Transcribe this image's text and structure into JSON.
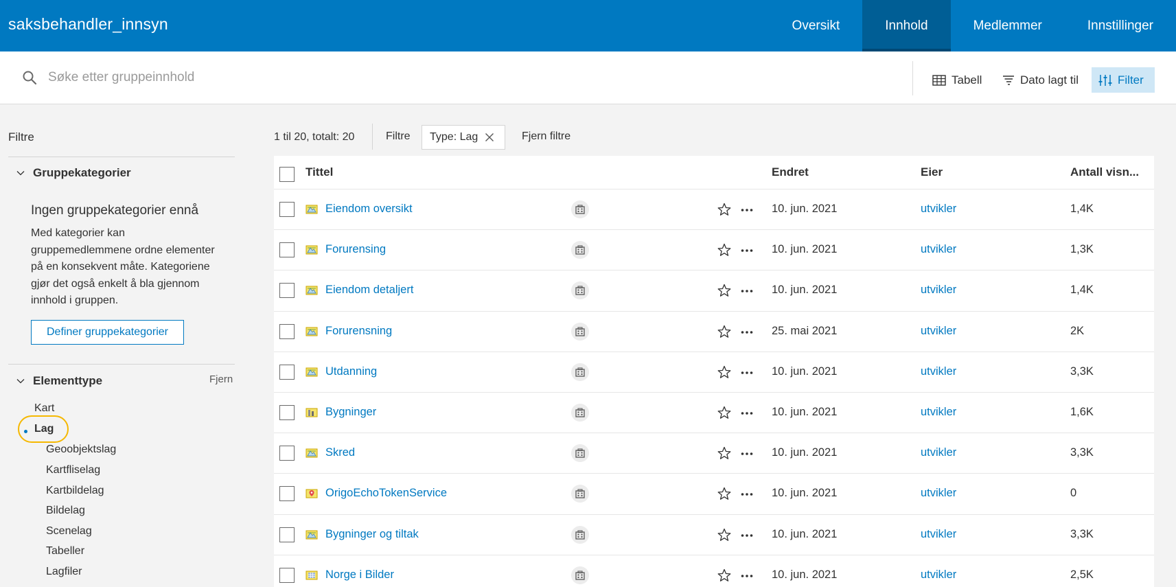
{
  "header": {
    "group_title": "saksbehandler_innsyn",
    "tabs": [
      {
        "label": "Oversikt",
        "active": false
      },
      {
        "label": "Innhold",
        "active": true
      },
      {
        "label": "Medlemmer",
        "active": false
      },
      {
        "label": "Innstillinger",
        "active": false
      }
    ]
  },
  "search": {
    "placeholder": "Søke etter gruppeinnhold",
    "value": ""
  },
  "toolbar": {
    "table_label": "Tabell",
    "sort_label": "Dato lagt til",
    "filter_label": "Filter"
  },
  "sidebar": {
    "title": "Filtre",
    "categories": {
      "heading": "Gruppekategorier",
      "empty_title": "Ingen gruppekategorier ennå",
      "empty_text": "Med kategorier kan gruppemedlemmene ordne elementer på en konsekvent måte. Kategoriene gjør det også enkelt å bla gjennom innhold i gruppen.",
      "define_button": "Definer gruppekategorier"
    },
    "element_type": {
      "heading": "Elementtype",
      "remove_label": "Fjern",
      "items": [
        {
          "label": "Kart",
          "level": 1,
          "selected": false
        },
        {
          "label": "Lag",
          "level": 1,
          "selected": true
        },
        {
          "label": "Geoobjektslag",
          "level": 2,
          "selected": false
        },
        {
          "label": "Kartfliselag",
          "level": 2,
          "selected": false
        },
        {
          "label": "Kartbildelag",
          "level": 2,
          "selected": false
        },
        {
          "label": "Bildelag",
          "level": 2,
          "selected": false
        },
        {
          "label": "Scenelag",
          "level": 2,
          "selected": false
        },
        {
          "label": "Tabeller",
          "level": 2,
          "selected": false
        },
        {
          "label": "Lagfiler",
          "level": 2,
          "selected": false
        }
      ]
    }
  },
  "results": {
    "count_text": "1 til 20, totalt: 20",
    "filters_label": "Filtre",
    "active_filter": "Type: Lag",
    "clear_label": "Fjern filtre",
    "columns": {
      "title": "Tittel",
      "modified": "Endret",
      "owner": "Eier",
      "views": "Antall visn..."
    },
    "rows": [
      {
        "title": "Eiendom oversikt",
        "icon": "feature-layer-icon",
        "modified": "10. jun. 2021",
        "owner": "utvikler",
        "views": "1,4K"
      },
      {
        "title": "Forurensing",
        "icon": "feature-layer-icon",
        "modified": "10. jun. 2021",
        "owner": "utvikler",
        "views": "1,3K"
      },
      {
        "title": "Eiendom detaljert",
        "icon": "feature-layer-icon",
        "modified": "10. jun. 2021",
        "owner": "utvikler",
        "views": "1,4K"
      },
      {
        "title": "Forurensning",
        "icon": "feature-layer-icon",
        "modified": "25. mai 2021",
        "owner": "utvikler",
        "views": "2K"
      },
      {
        "title": "Utdanning",
        "icon": "feature-layer-icon",
        "modified": "10. jun. 2021",
        "owner": "utvikler",
        "views": "3,3K"
      },
      {
        "title": "Bygninger",
        "icon": "scene-layer-icon",
        "modified": "10. jun. 2021",
        "owner": "utvikler",
        "views": "1,6K"
      },
      {
        "title": "Skred",
        "icon": "feature-layer-icon",
        "modified": "10. jun. 2021",
        "owner": "utvikler",
        "views": "3,3K"
      },
      {
        "title": "OrigoEchoTokenService",
        "icon": "map-service-icon",
        "modified": "10. jun. 2021",
        "owner": "utvikler",
        "views": "0"
      },
      {
        "title": "Bygninger og tiltak",
        "icon": "feature-layer-icon",
        "modified": "10. jun. 2021",
        "owner": "utvikler",
        "views": "3,3K"
      },
      {
        "title": "Norge i Bilder",
        "icon": "imagery-layer-icon",
        "modified": "10. jun. 2021",
        "owner": "utvikler",
        "views": "2,5K"
      }
    ]
  },
  "colors": {
    "brand": "#0079c1",
    "brand_dark": "#005e95",
    "highlight": "#f5b800"
  }
}
